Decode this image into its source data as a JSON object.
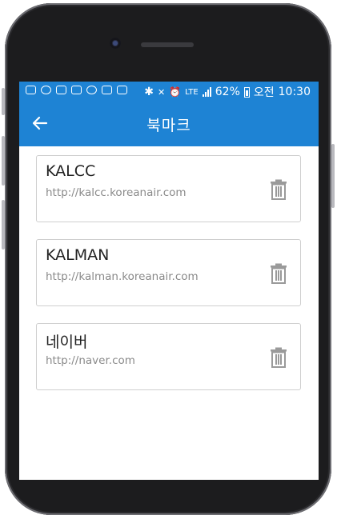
{
  "status": {
    "battery": "62%",
    "period": "오전",
    "time": "10:30",
    "network": "LTE",
    "left_icons": [
      "message-icon",
      "voicemail-icon",
      "record-icon",
      "record-icon",
      "chat-icon",
      "image-icon",
      "mail-icon"
    ]
  },
  "appbar": {
    "title": "북마크",
    "back_icon": "back-arrow-icon",
    "color": "#1e83d4"
  },
  "bookmarks": [
    {
      "title": "KALCC",
      "url": "http://kalcc.koreanair.com"
    },
    {
      "title": "KALMAN",
      "url": "http://kalman.koreanair.com"
    },
    {
      "title": "네이버",
      "url": "http://naver.com"
    }
  ]
}
